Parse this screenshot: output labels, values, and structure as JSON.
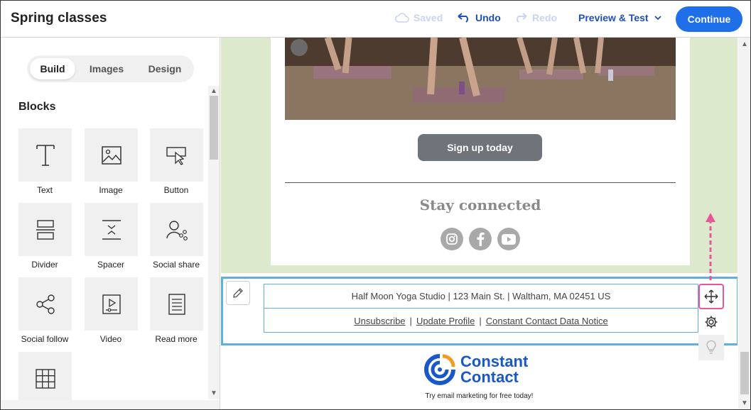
{
  "header": {
    "title": "Spring classes",
    "saved_label": "Saved",
    "undo_label": "Undo",
    "redo_label": "Redo",
    "preview_label": "Preview & Test",
    "continue_label": "Continue"
  },
  "sidebar": {
    "tabs": [
      {
        "label": "Build",
        "active": true
      },
      {
        "label": "Images",
        "active": false
      },
      {
        "label": "Design",
        "active": false
      }
    ],
    "heading": "Blocks",
    "blocks": [
      {
        "label": "Text",
        "icon": "text-icon"
      },
      {
        "label": "Image",
        "icon": "image-icon"
      },
      {
        "label": "Button",
        "icon": "button-icon"
      },
      {
        "label": "Divider",
        "icon": "divider-icon"
      },
      {
        "label": "Spacer",
        "icon": "spacer-icon"
      },
      {
        "label": "Social share",
        "icon": "social-share-icon"
      },
      {
        "label": "Social follow",
        "icon": "social-follow-icon"
      },
      {
        "label": "Video",
        "icon": "video-icon"
      },
      {
        "label": "Read more",
        "icon": "read-more-icon"
      },
      {
        "label": "",
        "icon": "table-icon"
      }
    ]
  },
  "email": {
    "signup_label": "Sign up today",
    "stay_connected": "Stay connected",
    "social_icons": [
      "instagram-icon",
      "facebook-icon",
      "youtube-icon"
    ],
    "footer": {
      "address": "Half Moon Yoga Studio | 123 Main St. | Waltham, MA 02451 US",
      "unsubscribe": "Unsubscribe",
      "update_profile": "Update Profile",
      "data_notice": "Constant Contact Data Notice",
      "separator": "|"
    },
    "brand_line1": "Constant",
    "brand_line2": "Contact",
    "tagline": "Try email marketing for free today!"
  },
  "colors": {
    "accent": "#1f6fe8",
    "link_blue": "#1f4fb8",
    "selection": "#5fb0dc",
    "highlight": "#e8579a",
    "canvas_bg": "#dde9cd"
  }
}
